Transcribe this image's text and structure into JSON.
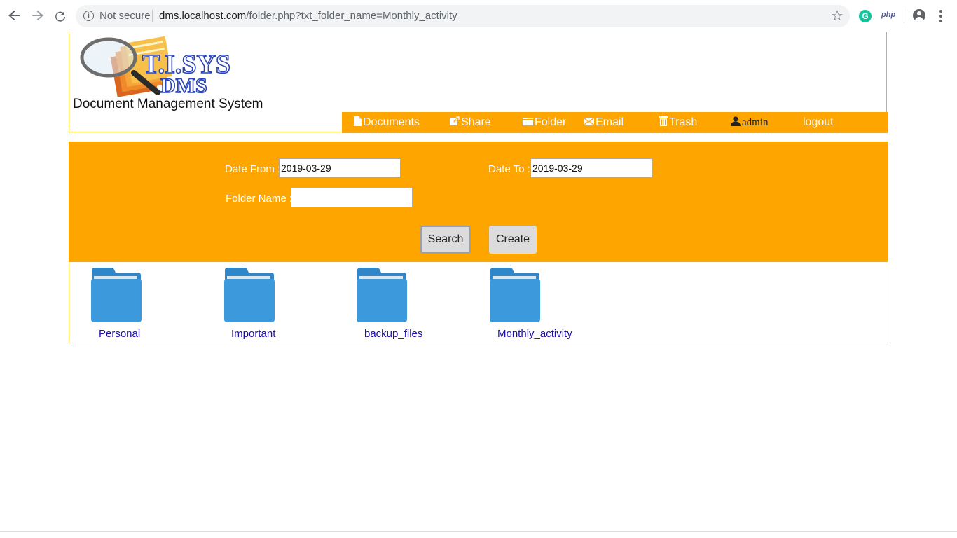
{
  "browser": {
    "security_label": "Not secure",
    "url_host": "dms.localhost.com",
    "url_path": "/folder.php?txt_folder_name=Monthly_activity",
    "icons": [
      "back-arrow-icon",
      "forward-arrow-icon",
      "reload-icon",
      "info-icon",
      "star-icon",
      "grammarly-extension-icon",
      "php-extension-icon",
      "profile-icon",
      "menu-dots-icon"
    ],
    "ext_g": "G",
    "ext_php": "php"
  },
  "header": {
    "logo_title": "T.I.SYS",
    "logo_subtitle": "DMS",
    "tagline": "Document Management System"
  },
  "nav": {
    "documents": "Documents",
    "share": "Share",
    "folder": "Folder",
    "email": "Email",
    "trash": "Trash",
    "admin": "admin",
    "logout": "logout"
  },
  "search": {
    "date_from_label": "Date From :",
    "date_from_value": "2019-03-29",
    "date_to_label": "Date To :",
    "date_to_value": "2019-03-29",
    "folder_name_label": "Folder Name :",
    "folder_name_value": "",
    "search_button": "Search",
    "create_button": "Create"
  },
  "folders": [
    "Personal",
    "Important",
    "backup_files",
    "Monthly_activity"
  ],
  "colors": {
    "accent": "#ffa500",
    "border": "#f4a81d",
    "folder_blue": "#3b99dc",
    "link": "#1a0dab"
  }
}
